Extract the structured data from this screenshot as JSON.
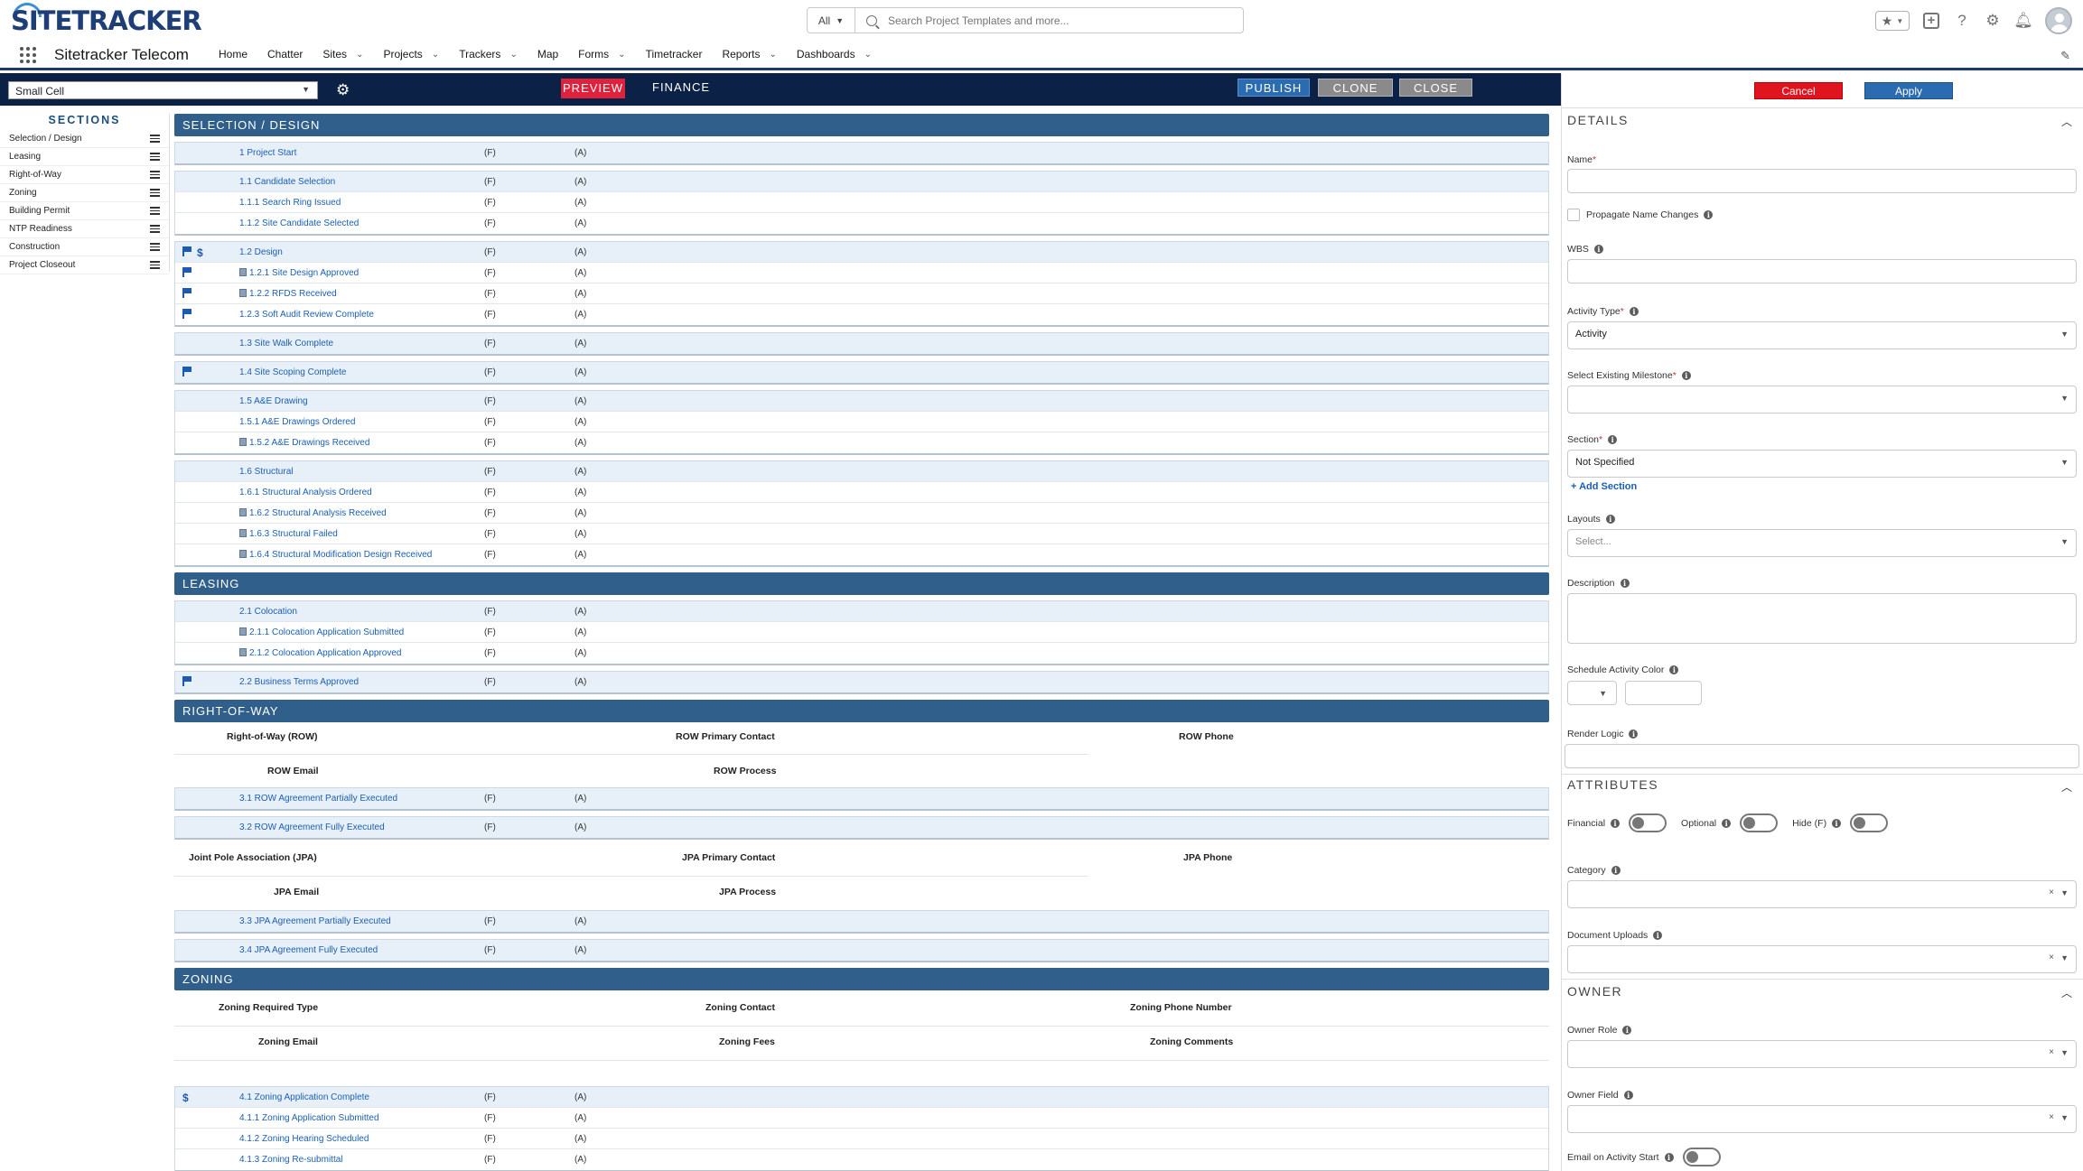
{
  "header": {
    "logo": "SITETRACKER",
    "app_name": "Sitetracker Telecom",
    "search_scope": "All",
    "search_placeholder": "Search Project Templates and more...",
    "nav": [
      {
        "label": "Home",
        "chevron": false
      },
      {
        "label": "Chatter",
        "chevron": false
      },
      {
        "label": "Sites",
        "chevron": true
      },
      {
        "label": "Projects",
        "chevron": true
      },
      {
        "label": "Trackers",
        "chevron": true
      },
      {
        "label": "Map",
        "chevron": false
      },
      {
        "label": "Forms",
        "chevron": true
      },
      {
        "label": "Timetracker",
        "chevron": false
      },
      {
        "label": "Reports",
        "chevron": true
      },
      {
        "label": "Dashboards",
        "chevron": true
      }
    ]
  },
  "toolbar": {
    "layout_value": "Small Cell",
    "preview": "PREVIEW",
    "finance": "FINANCE",
    "publish": "PUBLISH",
    "clone": "CLONE",
    "close": "CLOSE"
  },
  "sections_panel": {
    "title": "SECTIONS",
    "items": [
      "Selection / Design",
      "Leasing",
      "Right-of-Way",
      "Zoning",
      "Building Permit",
      "NTP Readiness",
      "Construction",
      "Project Closeout"
    ]
  },
  "content": {
    "selection_design": {
      "title": "SELECTION / DESIGN",
      "groups": [
        [
          {
            "label": "1 Project Start",
            "f": "(F)",
            "a": "(A)"
          }
        ],
        [
          {
            "label": "1.1 Candidate Selection",
            "f": "(F)",
            "a": "(A)"
          },
          {
            "label": "1.1.1 Search Ring Issued",
            "f": "(F)",
            "a": "(A)"
          },
          {
            "label": "1.1.2 Site Candidate Selected",
            "f": "(F)",
            "a": "(A)"
          }
        ],
        [
          {
            "label": "1.2 Design",
            "f": "(F)",
            "a": "(A)",
            "flag": true,
            "dollar": true
          },
          {
            "label": "1.2.1 Site Design Approved",
            "f": "(F)",
            "a": "(A)",
            "flag": true,
            "doc": true
          },
          {
            "label": "1.2.2 RFDS Received",
            "f": "(F)",
            "a": "(A)",
            "flag": true,
            "doc": true
          },
          {
            "label": "1.2.3 Soft Audit Review Complete",
            "f": "(F)",
            "a": "(A)",
            "flag": true
          }
        ],
        [
          {
            "label": "1.3 Site Walk Complete",
            "f": "(F)",
            "a": "(A)"
          }
        ],
        [
          {
            "label": "1.4 Site Scoping Complete",
            "f": "(F)",
            "a": "(A)",
            "flag": true
          }
        ],
        [
          {
            "label": "1.5 A&E Drawing",
            "f": "(F)",
            "a": "(A)"
          },
          {
            "label": "1.5.1 A&E Drawings Ordered",
            "f": "(F)",
            "a": "(A)"
          },
          {
            "label": "1.5.2 A&E Drawings Received",
            "f": "(F)",
            "a": "(A)",
            "doc": true
          }
        ],
        [
          {
            "label": "1.6 Structural",
            "f": "(F)",
            "a": "(A)"
          },
          {
            "label": "1.6.1 Structural Analysis Ordered",
            "f": "(F)",
            "a": "(A)"
          },
          {
            "label": "1.6.2 Structural Analysis Received",
            "f": "(F)",
            "a": "(A)",
            "doc": true
          },
          {
            "label": "1.6.3 Structural Failed",
            "f": "(F)",
            "a": "(A)",
            "doc": true
          },
          {
            "label": "1.6.4 Structural Modification Design Received",
            "f": "(F)",
            "a": "(A)",
            "doc": true
          }
        ]
      ]
    },
    "leasing": {
      "title": "LEASING",
      "groups": [
        [
          {
            "label": "2.1 Colocation",
            "f": "(F)",
            "a": "(A)"
          },
          {
            "label": "2.1.1 Colocation Application Submitted",
            "f": "(F)",
            "a": "(A)",
            "doc": true
          },
          {
            "label": "2.1.2 Colocation Application Approved",
            "f": "(F)",
            "a": "(A)",
            "doc": true
          }
        ],
        [
          {
            "label": "2.2 Business Terms Approved",
            "f": "(F)",
            "a": "(A)",
            "flag": true
          }
        ]
      ]
    },
    "row": {
      "title": "RIGHT-OF-WAY",
      "fields1": [
        "Right-of-Way (ROW)",
        "ROW Primary Contact",
        "ROW Phone",
        "ROW Email",
        "ROW Process"
      ],
      "groups1": [
        [
          {
            "label": "3.1 ROW Agreement Partially Executed",
            "f": "(F)",
            "a": "(A)"
          }
        ],
        [
          {
            "label": "3.2 ROW Agreement Fully Executed",
            "f": "(F)",
            "a": "(A)"
          }
        ]
      ],
      "fields2": [
        "Joint Pole Association (JPA)",
        "JPA Primary Contact",
        "JPA Phone",
        "JPA Email",
        "JPA Process"
      ],
      "groups2": [
        [
          {
            "label": "3.3 JPA Agreement Partially Executed",
            "f": "(F)",
            "a": "(A)"
          }
        ],
        [
          {
            "label": "3.4 JPA Agreement Fully Executed",
            "f": "(F)",
            "a": "(A)"
          }
        ]
      ]
    },
    "zoning": {
      "title": "ZONING",
      "fields": [
        "Zoning Required Type",
        "Zoning Contact",
        "Zoning Phone Number",
        "Zoning Email",
        "Zoning Fees",
        "Zoning Comments"
      ],
      "groups": [
        [
          {
            "label": "4.1 Zoning Application Complete",
            "f": "(F)",
            "a": "(A)",
            "dollar": true
          },
          {
            "label": "4.1.1 Zoning Application Submitted",
            "f": "(F)",
            "a": "(A)"
          },
          {
            "label": "4.1.2 Zoning Hearing Scheduled",
            "f": "(F)",
            "a": "(A)"
          },
          {
            "label": "4.1.3 Zoning Re-submittal",
            "f": "(F)",
            "a": "(A)"
          }
        ]
      ]
    }
  },
  "details": {
    "cancel": "Cancel",
    "apply": "Apply",
    "details_title": "DETAILS",
    "name_label": "Name",
    "propagate_label": "Propagate Name Changes",
    "wbs_label": "WBS",
    "activity_type_label": "Activity Type",
    "activity_type_value": "Activity",
    "milestone_label": "Select Existing Milestone",
    "section_label": "Section",
    "section_value": "Not Specified",
    "add_section": "Add Section",
    "layouts_label": "Layouts",
    "layouts_placeholder": "Select...",
    "description_label": "Description",
    "color_label": "Schedule Activity Color",
    "render_logic_label": "Render Logic",
    "attributes_title": "ATTRIBUTES",
    "financial_label": "Financial",
    "optional_label": "Optional",
    "hide_label": "Hide (F)",
    "category_label": "Category",
    "uploads_label": "Document Uploads",
    "owner_title": "OWNER",
    "owner_role_label": "Owner Role",
    "owner_field_label": "Owner Field",
    "email_start_label": "Email on Activity Start"
  }
}
